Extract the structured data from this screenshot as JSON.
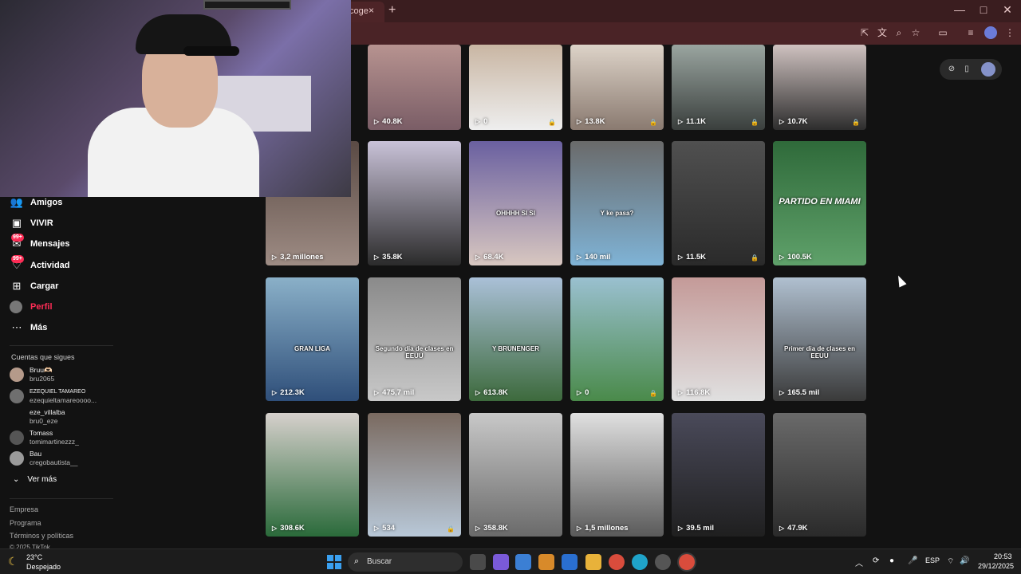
{
  "browser": {
    "tab_title": "coge",
    "tab_close": "×",
    "new_tab": "+",
    "window_controls": [
      "—",
      "□",
      "✕"
    ],
    "toolbar_icons": [
      "install-app-icon",
      "translate-icon",
      "zoom-icon",
      "star-icon",
      "sidebar-icon",
      "playlist-icon",
      "profile-icon",
      "menu-icon"
    ]
  },
  "sidebar": {
    "nav": [
      {
        "label": "Amigos",
        "icon": "friends-icon"
      },
      {
        "label": "VIVIR",
        "icon": "live-icon"
      },
      {
        "label": "Mensajes",
        "icon": "messages-icon",
        "badge": "99+"
      },
      {
        "label": "Actividad",
        "icon": "activity-icon",
        "badge": "99+"
      },
      {
        "label": "Cargar",
        "icon": "upload-icon"
      },
      {
        "label": "Perfil",
        "icon": "profile-icon",
        "active": true
      },
      {
        "label": "Más",
        "icon": "more-icon"
      }
    ],
    "following_title": "Cuentas que sigues",
    "following": [
      {
        "name": "Bruu🫶🏻",
        "user": "bru2065"
      },
      {
        "name": "EZEQUIEL TAMAREO",
        "user": "ezequieltamareoooo..."
      },
      {
        "name": "eze_villalba",
        "user": "bru0_eze"
      },
      {
        "name": "Tomass",
        "user": "tomimartinezzz_"
      },
      {
        "name": "Bau",
        "user": "cregobautista__"
      }
    ],
    "see_more": "Ver más",
    "footer": [
      "Empresa",
      "Programa",
      "Términos y políticas",
      "© 2025 TikTok"
    ]
  },
  "videos": [
    {
      "views": "40.8K",
      "locked": false
    },
    {
      "views": "0",
      "locked": true
    },
    {
      "views": "13.8K",
      "locked": true
    },
    {
      "views": "11.1K",
      "locked": true
    },
    {
      "views": "10.7K",
      "locked": true
    },
    {
      "views": "3,2 millones",
      "locked": false
    },
    {
      "views": "35.8K",
      "locked": false
    },
    {
      "views": "68.4K",
      "locked": false,
      "caption": "OHHHH SI SI"
    },
    {
      "views": "140 mil",
      "locked": false,
      "caption": "Y ke pasa?"
    },
    {
      "views": "11.5K",
      "locked": true
    },
    {
      "views": "100.5K",
      "locked": false,
      "caption_big": "PARTIDO EN MIAMI"
    },
    {
      "views": "212.3K",
      "locked": false,
      "caption": "GRAN LIGA"
    },
    {
      "views": "475,7 mil",
      "locked": false,
      "caption": "Segundo dia de clases en EEUU"
    },
    {
      "views": "613.8K",
      "locked": false,
      "caption": "Y BRUNENGER"
    },
    {
      "views": "0",
      "locked": true
    },
    {
      "views": "116.8K",
      "locked": false
    },
    {
      "views": "165.5 mil",
      "locked": false,
      "caption": "Primer dia de clases en EEUU"
    },
    {
      "views": "308.6K",
      "locked": false
    },
    {
      "views": "534",
      "locked": true
    },
    {
      "views": "358.8K",
      "locked": false
    },
    {
      "views": "1,5 millones",
      "locked": false
    },
    {
      "views": "39.5 mil",
      "locked": false
    },
    {
      "views": "47.9K",
      "locked": false
    }
  ],
  "taskbar": {
    "temperature": "23°C",
    "condition": "Despejado",
    "search_placeholder": "Buscar",
    "language": "ESP",
    "time": "20:53",
    "date": "29/12/2025"
  }
}
